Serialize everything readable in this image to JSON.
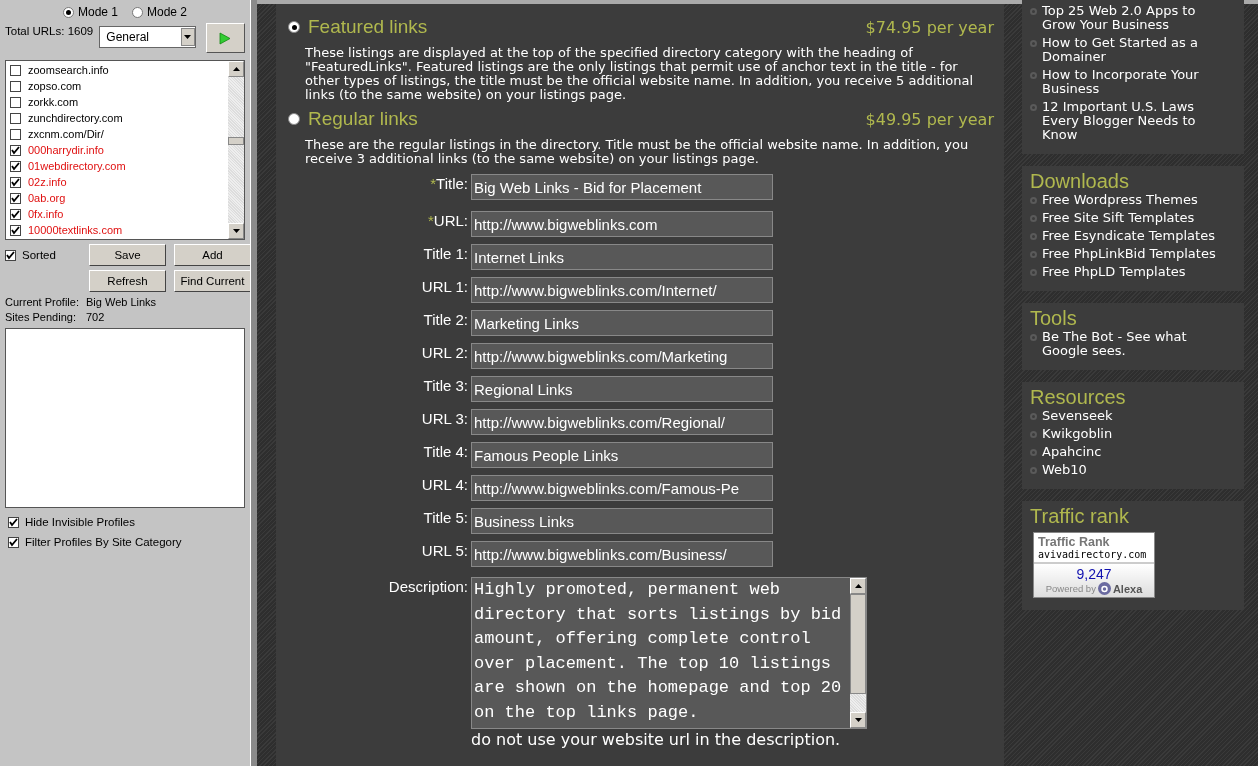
{
  "left_panel": {
    "modes": [
      {
        "label": "Mode 1",
        "selected": true
      },
      {
        "label": "Mode 2",
        "selected": false
      }
    ],
    "total_urls": "Total URLs: 1609",
    "category_dropdown": {
      "value": "General"
    },
    "sites": [
      {
        "url": "zoomsearch.info",
        "checked": false
      },
      {
        "url": "zopso.com",
        "checked": false
      },
      {
        "url": "zorkk.com",
        "checked": false
      },
      {
        "url": "zunchdirectory.com",
        "checked": false
      },
      {
        "url": "zxcnm.com/Dir/",
        "checked": false
      },
      {
        "url": "000harrydir.info",
        "checked": true
      },
      {
        "url": "01webdirectory.com",
        "checked": true
      },
      {
        "url": "02z.info",
        "checked": true
      },
      {
        "url": "0ab.org",
        "checked": true
      },
      {
        "url": "0fx.info",
        "checked": true
      },
      {
        "url": "10000textlinks.com",
        "checked": true
      }
    ],
    "sorted": {
      "label": "Sorted",
      "checked": true
    },
    "buttons": [
      "Save",
      "Add",
      "Refresh",
      "Find Current"
    ],
    "profile_info": [
      {
        "label": "Current Profile:",
        "value": "Big Web Links"
      },
      {
        "label": "Sites Pending:",
        "value": "702"
      }
    ],
    "options": [
      {
        "label": "Hide Invisible Profiles",
        "checked": true
      },
      {
        "label": "Filter Profiles By Site Category",
        "checked": true
      }
    ]
  },
  "listing_options": [
    {
      "title": "Featured links",
      "price": "$74.95 per year",
      "selected": true,
      "description": "These listings are displayed at the top of the specified directory category with the heading of \"FeaturedLinks\". Featured listings are the only listings that permit use of anchor text in the title - for other types of listings, the title must be the official website name. In addition, you receive 5 additional links (to the same website) on your listings page."
    },
    {
      "title": "Regular links",
      "price": "$49.95 per year",
      "selected": false,
      "description": "These are the regular listings in the directory. Title must be the official website name. In addition, you receive 3 additional links (to the same website) on your listings page."
    }
  ],
  "form_fields": [
    {
      "marker": "*",
      "label": "Title:",
      "value": "Big Web Links - Bid for Placement"
    },
    {
      "marker": "*",
      "label": "URL:",
      "value": "http://www.bigweblinks.com"
    },
    {
      "label": "Title 1:",
      "value": "Internet Links"
    },
    {
      "label": "URL 1:",
      "value": "http://www.bigweblinks.com/Internet/"
    },
    {
      "label": "Title 2:",
      "value": "Marketing Links"
    },
    {
      "label": "URL 2:",
      "value": "http://www.bigweblinks.com/Marketing"
    },
    {
      "label": "Title 3:",
      "value": "Regional Links"
    },
    {
      "label": "URL 3:",
      "value": "http://www.bigweblinks.com/Regional/"
    },
    {
      "label": "Title 4:",
      "value": "Famous People Links"
    },
    {
      "label": "URL 4:",
      "value": "http://www.bigweblinks.com/Famous-Pe"
    },
    {
      "label": "Title 5:",
      "value": "Business Links"
    },
    {
      "label": "URL 5:",
      "value": "http://www.bigweblinks.com/Business/"
    }
  ],
  "description": {
    "label": "Description:",
    "value": "Highly promoted, permanent web directory that sorts listings by bid amount, offering complete control over placement. The top 10 listings are shown on the homepage and top 20 on the top links page.",
    "note": "do not use your website url in the description."
  },
  "sidebar": {
    "sections": [
      {
        "items": [
          "Top 25 Web 2.0 Apps to Grow Your Business",
          "How to Get Started as a Domainer",
          "How to Incorporate Your Business",
          "12 Important U.S. Laws Every Blogger Needs to Know"
        ]
      },
      {
        "title": "Downloads",
        "items": [
          "Free Wordpress Themes",
          "Free Site Sift Templates",
          "Free Esyndicate Templates",
          "Free PhpLinkBid Templates",
          "Free PhpLD Templates"
        ]
      },
      {
        "title": "Tools",
        "items": [
          "Be The Bot - See what Google sees."
        ]
      },
      {
        "title": "Resources",
        "items": [
          "Sevenseek",
          "Kwikgoblin",
          "Apahcinc",
          "Web10"
        ]
      }
    ],
    "traffic": {
      "title": "Traffic rank",
      "widget_title": "Traffic Rank",
      "site": "avivadirectory.com",
      "rank": "9,247",
      "powered_by": "Powered by",
      "brand": "Alexa"
    }
  }
}
